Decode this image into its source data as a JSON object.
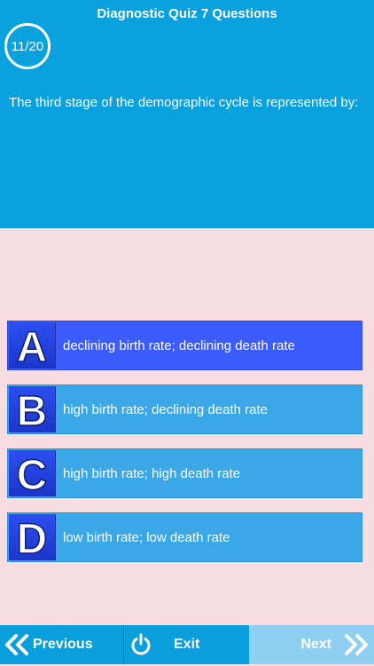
{
  "header": {
    "title": "Diagnostic Quiz 7 Questions",
    "progress": "11/20",
    "question": "The third stage of the demographic cycle is represented by:"
  },
  "options": [
    {
      "letter": "A",
      "text": "declining birth rate; declining death rate",
      "selected": true
    },
    {
      "letter": "B",
      "text": "high birth rate; declining death rate",
      "selected": false
    },
    {
      "letter": "C",
      "text": "high birth rate; high death rate",
      "selected": false
    },
    {
      "letter": "D",
      "text": "low birth rate; low death rate",
      "selected": false
    }
  ],
  "footer": {
    "previous_label": "Previous",
    "exit_label": "Exit",
    "next_label": "Next",
    "previous_icon": "double-chevron-left-icon",
    "exit_icon": "power-icon",
    "next_icon": "double-chevron-right-icon"
  },
  "colors": {
    "header_bg": "#0aa2de",
    "body_bg": "#f7dde1",
    "option_bg": "#3aa8e6",
    "option_selected_bg": "#3b5bfa",
    "letter_bg": "#1f3fd9",
    "next_disabled_bg": "#8ecff2"
  }
}
